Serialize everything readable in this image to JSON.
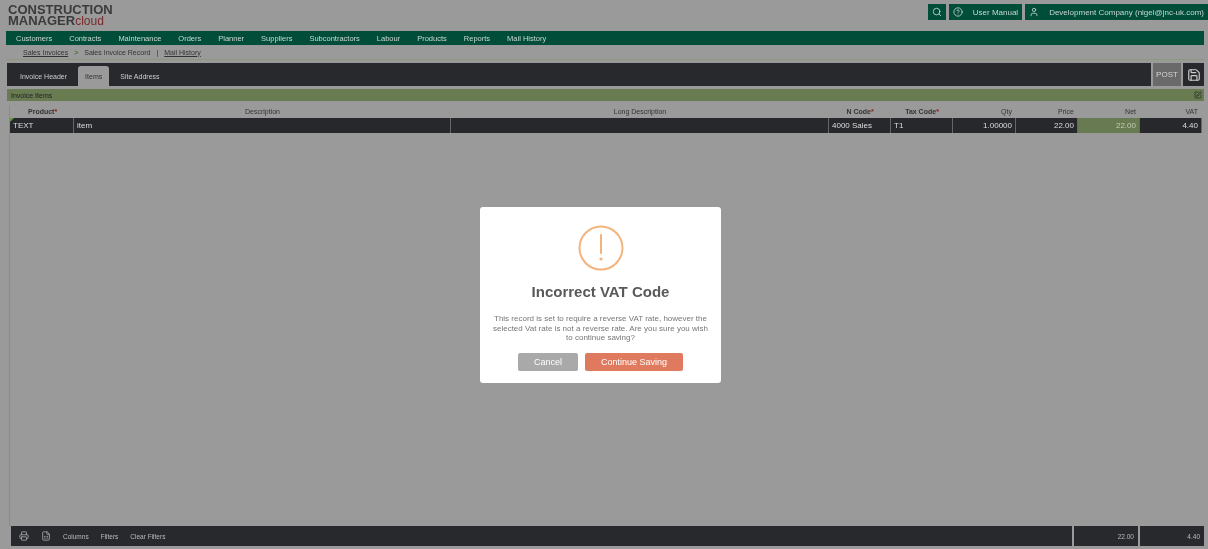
{
  "logo": {
    "line1": "CONSTRUCTION",
    "line2": "MANAGER",
    "suffix": "cloud"
  },
  "top_actions": {
    "help": "User Manual",
    "account": "Development Company (nigel@jnc-uk.com)"
  },
  "nav": [
    "Customers",
    "Contracts",
    "Maintenance",
    "Orders",
    "Planner",
    "Suppliers",
    "Subcontractors",
    "Labour",
    "Products",
    "Reports",
    "Mail History"
  ],
  "breadcrumb": [
    {
      "label": "Sales Invoices",
      "kind": "link"
    },
    {
      "label": ">",
      "kind": "chevron"
    },
    {
      "label": "Sales Invoice Record",
      "kind": "current"
    },
    {
      "label": "|",
      "kind": "pipe"
    },
    {
      "label": "Mail History",
      "kind": "link"
    }
  ],
  "tabs": [
    {
      "label": "Invoice Header",
      "selected": false
    },
    {
      "label": "Items",
      "selected": true
    },
    {
      "label": "Site Address",
      "selected": false
    }
  ],
  "post_button": {
    "label": "POST",
    "disabled": true
  },
  "section_title": "Invoice Items",
  "table": {
    "columns": [
      {
        "label": "Product",
        "required_mark": "*"
      },
      {
        "label": "Description"
      },
      {
        "label": "Long Description"
      },
      {
        "label": "N Code",
        "required_mark": "*"
      },
      {
        "label": "Tax Code",
        "required_mark": "*"
      },
      {
        "label": "Qty"
      },
      {
        "label": "Price"
      },
      {
        "label": "Net"
      },
      {
        "label": "VAT"
      }
    ],
    "rows": [
      {
        "cells": [
          {
            "text": "TEXT",
            "selected": false
          },
          {
            "text": "item",
            "selected": false
          },
          {
            "selected": false
          },
          {
            "text": "4000 Sales",
            "selected": false
          },
          {
            "text": "T1",
            "selected": false
          },
          {
            "text": "1.00000",
            "selected": false
          },
          {
            "text": "22.00",
            "selected": false
          },
          {
            "text": "22.00",
            "selected": true
          },
          {
            "text": "4.40",
            "selected": false
          }
        ]
      }
    ]
  },
  "footer": {
    "links": [
      "Columns",
      "Filters",
      "Clear Filters"
    ],
    "totals": [
      "22.00",
      "4.40"
    ]
  },
  "dialog": {
    "title": "Incorrect VAT Code",
    "message": "This record is set to require a reverse VAT rate, however the selected Vat rate is not a reverse rate. Are you sure you wish to continue saving?",
    "buttons": [
      {
        "label": "Cancel",
        "kind": "secondary"
      },
      {
        "label": "Continue Saving",
        "kind": "primary"
      }
    ]
  }
}
